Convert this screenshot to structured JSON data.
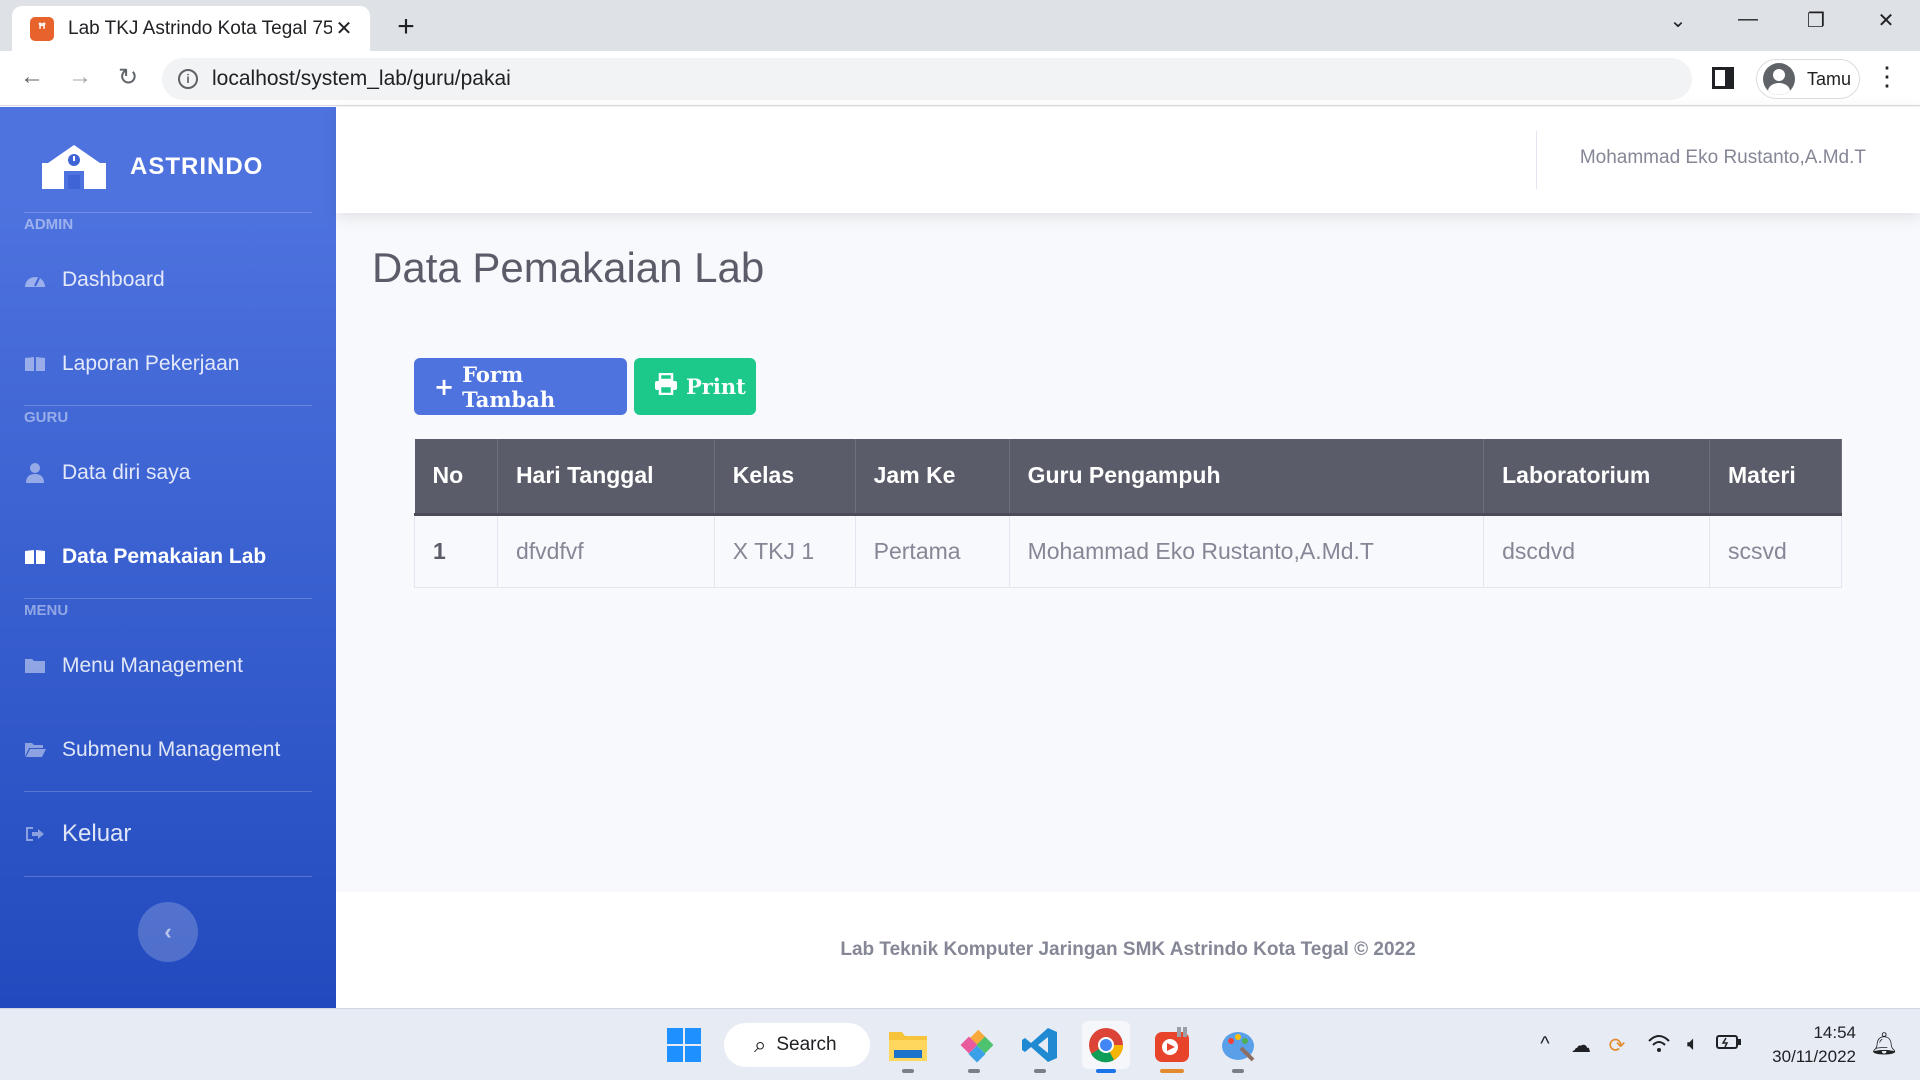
{
  "browser": {
    "tab_title": "Lab TKJ Astrindo Kota Tegal 75",
    "tab_close": "✕",
    "new_tab": "+",
    "url": "localhost/system_lab/guru/pakai",
    "profile_label": "Tamu"
  },
  "sidebar": {
    "brand": "ASTRINDO",
    "sections": {
      "admin": "ADMIN",
      "guru": "GURU",
      "menu": "MENU"
    },
    "items": [
      {
        "label": "Dashboard",
        "icon": "tachometer-icon"
      },
      {
        "label": "Laporan Pekerjaan",
        "icon": "book-icon"
      },
      {
        "label": "Data diri saya",
        "icon": "user-icon"
      },
      {
        "label": "Data Pemakaian Lab",
        "icon": "book-open-icon",
        "active": true
      },
      {
        "label": "Menu Management",
        "icon": "folder-icon"
      },
      {
        "label": "Submenu Management",
        "icon": "folder-open-icon"
      },
      {
        "label": "Keluar",
        "icon": "sign-out-icon"
      }
    ],
    "toggle": "‹"
  },
  "topbar": {
    "user_name": "Mohammad Eko Rustanto,A.Md.T"
  },
  "page": {
    "title": "Data Pemakaian Lab",
    "add_button": "Form Tambah",
    "print_button": "Print"
  },
  "table": {
    "headers": [
      "No",
      "Hari Tanggal",
      "Kelas",
      "Jam Ke",
      "Guru Pengampuh",
      "Laboratorium",
      "Materi"
    ],
    "rows": [
      [
        "1",
        "dfvdfvf",
        "X TKJ 1",
        "Pertama",
        "Mohammad Eko Rustanto,A.Md.T",
        "dscdvd",
        "scsvd"
      ]
    ]
  },
  "footer": {
    "text": "Lab Teknik Komputer Jaringan SMK Astrindo Kota Tegal © 2022"
  },
  "taskbar": {
    "search_label": "Search",
    "time": "14:54",
    "date": "30/11/2022"
  },
  "colors": {
    "primary": "#4e73df",
    "success": "#1cc88a",
    "table_header": "#5a5c69"
  }
}
